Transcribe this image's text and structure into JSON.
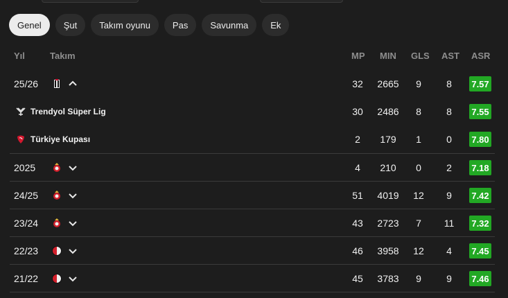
{
  "tabs": [
    {
      "label": "Genel",
      "active": true
    },
    {
      "label": "Şut",
      "active": false
    },
    {
      "label": "Takım oyunu",
      "active": false
    },
    {
      "label": "Pas",
      "active": false
    },
    {
      "label": "Savunma",
      "active": false
    },
    {
      "label": "Ek",
      "active": false
    }
  ],
  "header": {
    "year": "Yıl",
    "team": "Takım",
    "mp": "MP",
    "min": "MIN",
    "gls": "GLS",
    "ast": "AST",
    "asr": "ASR"
  },
  "rows": [
    {
      "year": "25/26",
      "club": "besiktas",
      "expanded": true,
      "mp": "32",
      "min": "2665",
      "gls": "9",
      "ast": "8",
      "asr": "7.57"
    },
    {
      "competition": "Trendyol Süper Lig",
      "icon": "super-lig",
      "mp": "30",
      "min": "2486",
      "gls": "8",
      "ast": "8",
      "asr": "7.55"
    },
    {
      "competition": "Türkiye Kupası",
      "icon": "turkiye-kupasi",
      "mp": "2",
      "min": "179",
      "gls": "1",
      "ast": "0",
      "asr": "7.80"
    },
    {
      "year": "2025",
      "club": "benfica",
      "expanded": false,
      "mp": "4",
      "min": "210",
      "gls": "0",
      "ast": "2",
      "asr": "7.18"
    },
    {
      "year": "24/25",
      "club": "benfica",
      "expanded": false,
      "mp": "51",
      "min": "4019",
      "gls": "12",
      "ast": "9",
      "asr": "7.42"
    },
    {
      "year": "23/24",
      "club": "benfica",
      "expanded": false,
      "mp": "43",
      "min": "2723",
      "gls": "7",
      "ast": "11",
      "asr": "7.32"
    },
    {
      "year": "22/23",
      "club": "feyenoord",
      "expanded": false,
      "mp": "46",
      "min": "3958",
      "gls": "12",
      "ast": "4",
      "asr": "7.45"
    },
    {
      "year": "21/22",
      "club": "feyenoord",
      "expanded": false,
      "mp": "45",
      "min": "3783",
      "gls": "9",
      "ast": "9",
      "asr": "7.46"
    }
  ],
  "colors": {
    "rating_green": "#22a824",
    "background": "#1d1d1d"
  }
}
